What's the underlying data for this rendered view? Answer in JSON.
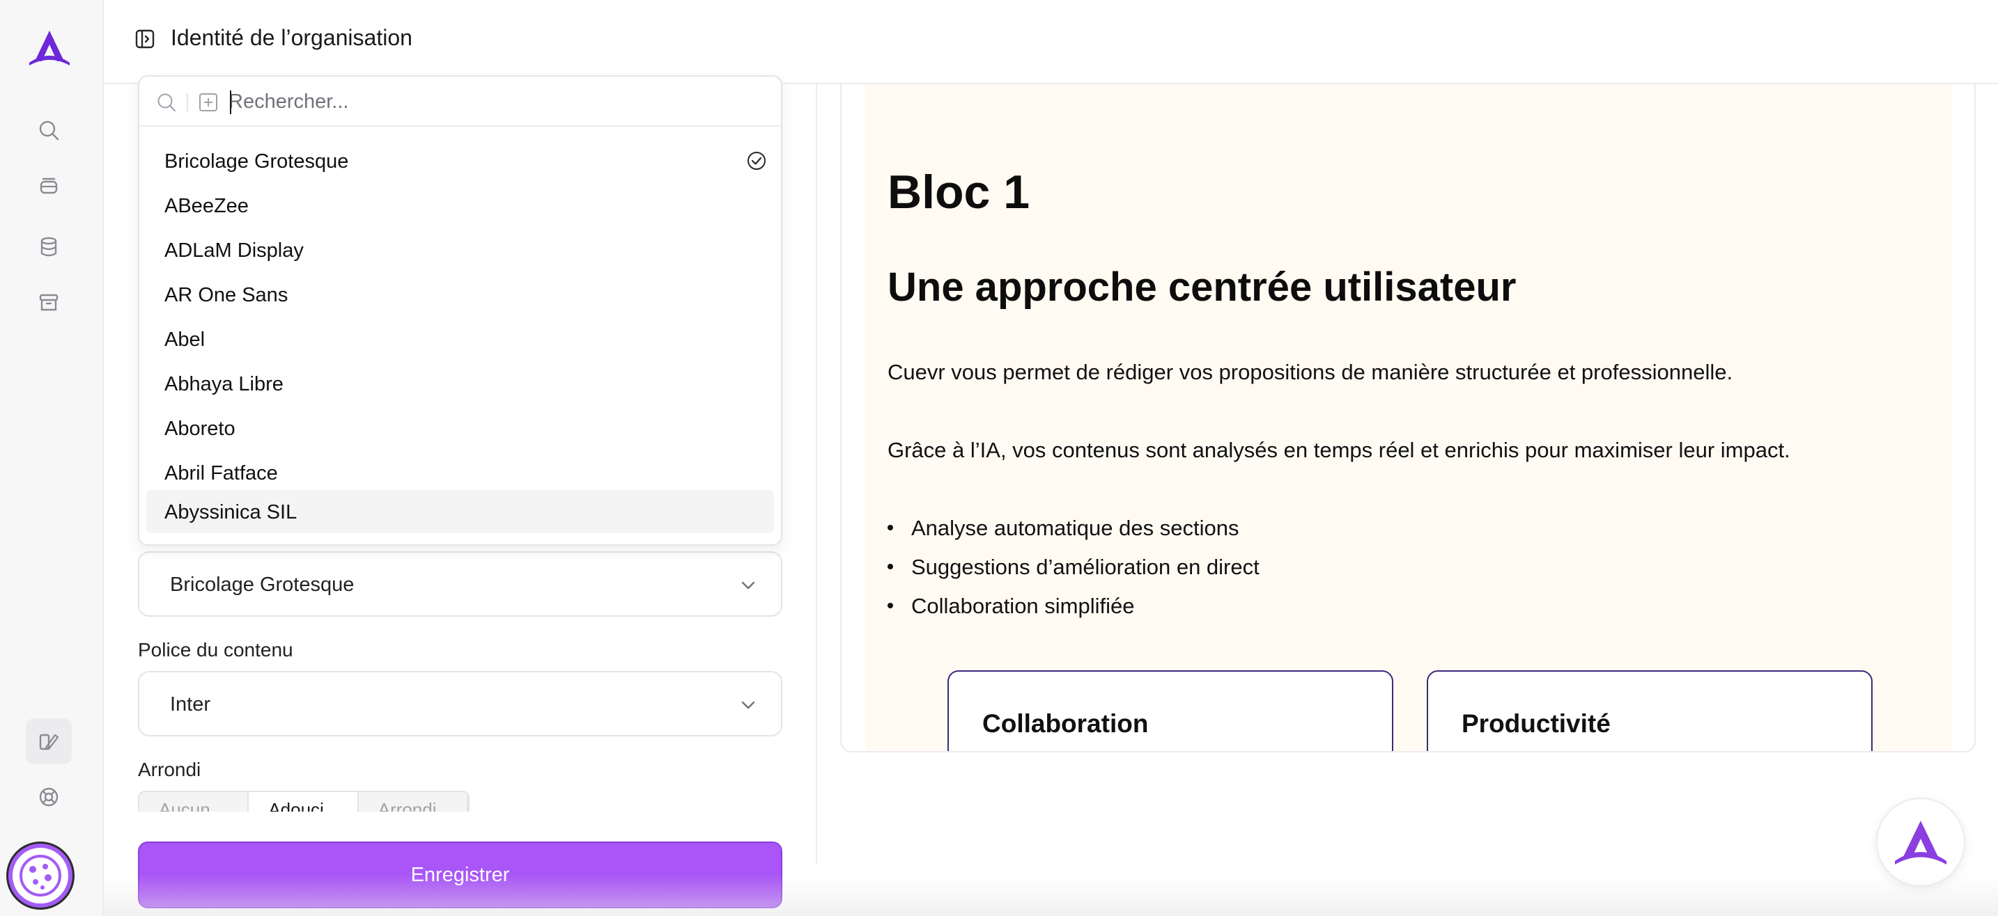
{
  "app": {
    "brand_color": "#6d28d9",
    "accent_color": "#a955f7"
  },
  "header": {
    "title": "Identité de l’organisation",
    "toggle_icon": "sidebar-toggle-icon"
  },
  "rail": {
    "items": [
      {
        "icon": "search-icon"
      },
      {
        "icon": "layers-icon"
      },
      {
        "icon": "database-icon"
      },
      {
        "icon": "archive-icon"
      },
      {
        "icon": "brush-icon",
        "active": true
      },
      {
        "icon": "help-buoy-icon"
      }
    ]
  },
  "font_picker": {
    "search_placeholder": "Rechercher...",
    "options": [
      {
        "label": "Bricolage Grotesque",
        "selected": true
      },
      {
        "label": "ABeeZee"
      },
      {
        "label": "ADLaM Display"
      },
      {
        "label": "AR One Sans"
      },
      {
        "label": "Abel"
      },
      {
        "label": "Abhaya Libre"
      },
      {
        "label": "Aboreto"
      },
      {
        "label": "Abril Fatface"
      },
      {
        "label": "Abyssinica SIL",
        "hovered": true
      }
    ]
  },
  "settings": {
    "title_font_value": "Bricolage Grotesque",
    "content_font_label": "Police du contenu",
    "content_font_value": "Inter",
    "rounding_label": "Arrondi",
    "rounding_options": [
      "Aucun",
      "Adouci",
      "Arrondi"
    ],
    "rounding_selected": "Adouci",
    "save_label": "Enregistrer"
  },
  "preview": {
    "block_title": "Bloc 1",
    "heading": "Une approche centrée utilisateur",
    "paragraph_1": "Cuevr vous permet de rédiger vos propositions de manière structurée et professionnelle.",
    "paragraph_2": "Grâce à l’IA, vos contenus sont analysés en temps réel et enrichis pour maximiser leur impact.",
    "bullets": [
      "Analyse automatique des sections",
      "Suggestions d’amélioration en direct",
      "Collaboration simplifiée"
    ],
    "cards": [
      "Collaboration",
      "Productivité"
    ],
    "background_color": "#fffbf3",
    "card_border_color": "#3b2a7a"
  }
}
